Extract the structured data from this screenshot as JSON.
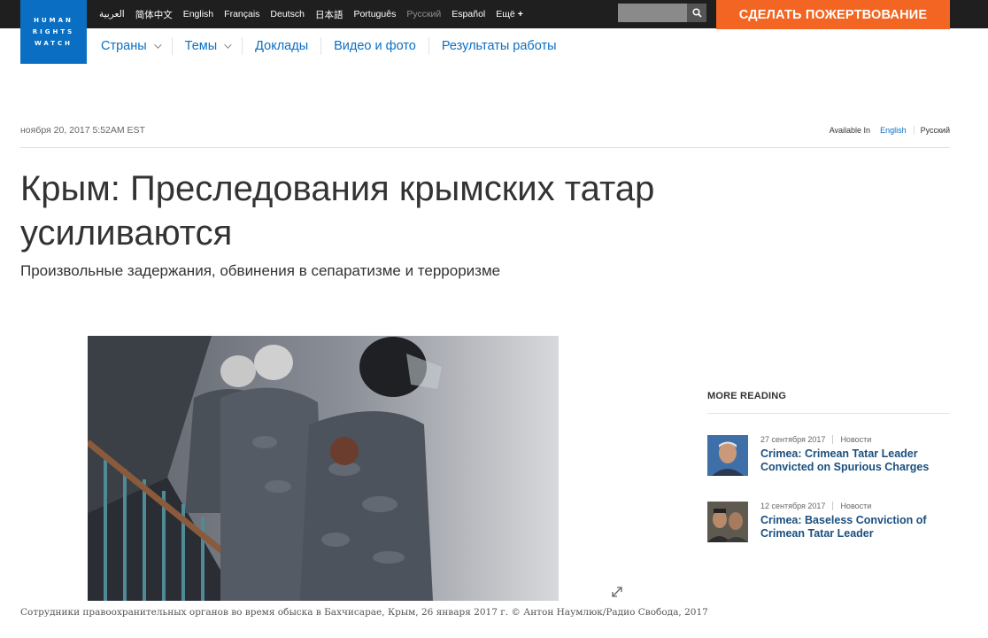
{
  "brand": {
    "logo_lines": [
      "HUMAN",
      "RIGHTS",
      "WATCH"
    ],
    "accent": "#0a6fc2",
    "donate_color": "#f26522"
  },
  "languages": [
    {
      "label": "العربية",
      "active": true
    },
    {
      "label": "简体中文",
      "active": true
    },
    {
      "label": "English",
      "active": true
    },
    {
      "label": "Français",
      "active": true
    },
    {
      "label": "Deutsch",
      "active": true
    },
    {
      "label": "日本語",
      "active": true
    },
    {
      "label": "Português",
      "active": true
    },
    {
      "label": "Русский",
      "active": false
    },
    {
      "label": "Español",
      "active": true
    },
    {
      "label": "Ещё",
      "active": true
    }
  ],
  "languages_more_symbol": "+",
  "search": {
    "placeholder": "",
    "icon": "search-icon"
  },
  "donate_label": "СДЕЛАТЬ ПОЖЕРТВОВАНИЕ",
  "nav": [
    {
      "label": "Страны",
      "dropdown": true
    },
    {
      "label": "Темы",
      "dropdown": true
    },
    {
      "label": "Доклады",
      "dropdown": false
    },
    {
      "label": "Видео и фото",
      "dropdown": false
    },
    {
      "label": "Результаты работы",
      "dropdown": false
    }
  ],
  "article": {
    "date": "ноября 20, 2017 5:52AM EST",
    "available_in_label": "Available In",
    "available_langs": [
      "English",
      "Русский"
    ],
    "title": "Крым: Преследования крымских татар усиливаются",
    "subtitle": "Произвольные задержания, обвинения в сепаратизме и терроризме",
    "photo_credit": "Anton Naumlyuk (RFE/RL)",
    "caption": "Сотрудники правоохранительных органов во время обыска в Бахчисарае, Крым, 26 января 2017 г. © Антон Наумлюк/Радио Свобода, 2017"
  },
  "more_reading": {
    "heading": "MORE READING",
    "items": [
      {
        "date": "27 сентября 2017",
        "category": "Новости",
        "title": "Crimea: Crimean Tatar Leader Convicted on Spurious Charges"
      },
      {
        "date": "12 сентября 2017",
        "category": "Новости",
        "title": "Crimea: Baseless Conviction of Crimean Tatar Leader"
      }
    ]
  }
}
